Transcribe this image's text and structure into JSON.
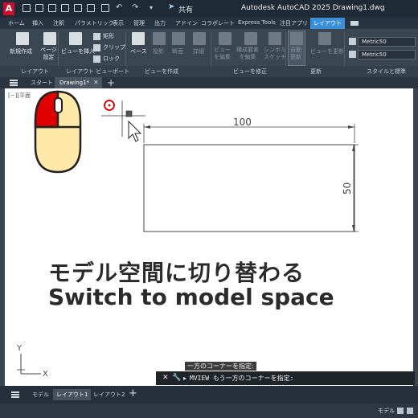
{
  "titlebar": {
    "app_logo": "A",
    "share": "共有",
    "title": "Autodesk AutoCAD 2025   Drawing1.dwg"
  },
  "ribbon_tabs": [
    "ホーム",
    "挿入",
    "注釈",
    "パラメトリック",
    "表示",
    "管理",
    "出力",
    "アドイン",
    "コラボレート",
    "Express Tools",
    "注目アプリ",
    "レイアウト"
  ],
  "ribbon_active_tab": "レイアウト",
  "ribbon": {
    "new_layout": "新規作成",
    "page_setup": "ページ\n設定",
    "insert_view": "ビューを挿入",
    "rect": "矩形",
    "clip": "クリップ",
    "lock": "ロック",
    "base": "ベース",
    "projected": "投影",
    "section": "断面",
    "detail": "詳細",
    "edit_view": "ビュー\nを編集",
    "edit_components": "構成要素\nを編集",
    "symbol_sketch": "シンボル\nスケッチ",
    "auto_update": "自動\n更新",
    "update_view": "ビューを更新",
    "dim_style": "Metric50",
    "text_style": "Metric50"
  },
  "panel_labels": {
    "layout": "レイアウト",
    "layout_viewport": "レイアウト ビューポート",
    "create_view": "ビューを作成",
    "modify_view": "ビューを修正",
    "update": "更新",
    "styles": "スタイルと標準"
  },
  "doc_tabs": {
    "start": "スタート",
    "drawing": "Drawing1*"
  },
  "canvas": {
    "viewport_label": "[−][平面",
    "dim_horizontal": "100",
    "dim_vertical": "50",
    "ucs_y": "Y",
    "ucs_x": "X"
  },
  "overlay": {
    "japanese": "モデル空間に切り替わる",
    "english": "Switch to model space"
  },
  "command": {
    "history": "一方のコーナーを指定:",
    "input_value": "MVIEW もう一方のコーナーを指定:"
  },
  "layout_tabs": [
    "モデル",
    "レイアウト1",
    "レイアウト2"
  ],
  "layout_active": "レイアウト1",
  "status": {
    "mode": "モデル"
  },
  "colors": {
    "accent": "#3a8fd6",
    "mouse_highlight": "#e00000",
    "mouse_body": "#fde8a8"
  }
}
